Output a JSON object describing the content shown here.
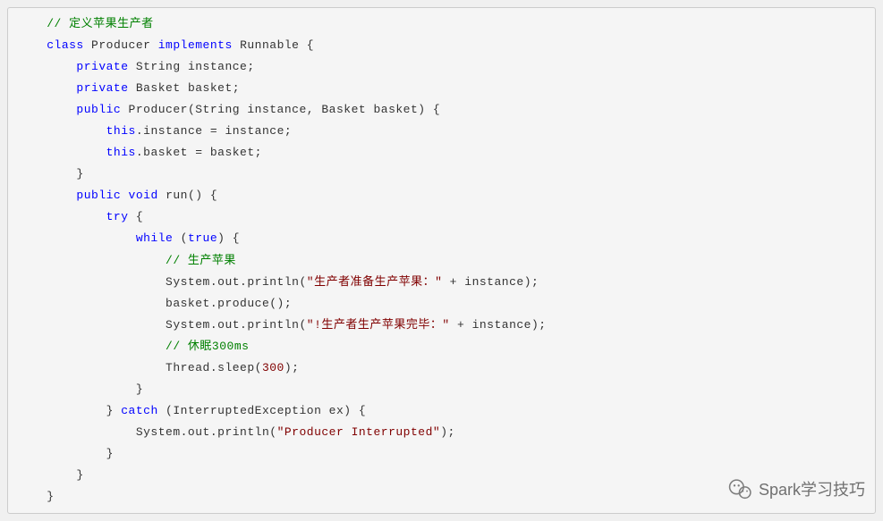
{
  "code": {
    "lines": [
      {
        "indent": 1,
        "tokens": [
          {
            "t": "comment",
            "v": "// 定义苹果生产者"
          }
        ]
      },
      {
        "indent": 1,
        "tokens": [
          {
            "t": "keyword",
            "v": "class"
          },
          {
            "t": "plain",
            "v": " Producer "
          },
          {
            "t": "keyword",
            "v": "implements"
          },
          {
            "t": "plain",
            "v": " Runnable {"
          }
        ]
      },
      {
        "indent": 2,
        "tokens": [
          {
            "t": "keyword",
            "v": "private"
          },
          {
            "t": "plain",
            "v": " String instance;"
          }
        ]
      },
      {
        "indent": 2,
        "tokens": [
          {
            "t": "keyword",
            "v": "private"
          },
          {
            "t": "plain",
            "v": " Basket basket;"
          }
        ]
      },
      {
        "indent": 0,
        "tokens": [
          {
            "t": "plain",
            "v": ""
          }
        ]
      },
      {
        "indent": 2,
        "tokens": [
          {
            "t": "keyword",
            "v": "public"
          },
          {
            "t": "plain",
            "v": " Producer(String instance, Basket basket) {"
          }
        ]
      },
      {
        "indent": 3,
        "tokens": [
          {
            "t": "keyword",
            "v": "this"
          },
          {
            "t": "plain",
            "v": ".instance = instance;"
          }
        ]
      },
      {
        "indent": 3,
        "tokens": [
          {
            "t": "keyword",
            "v": "this"
          },
          {
            "t": "plain",
            "v": ".basket = basket;"
          }
        ]
      },
      {
        "indent": 2,
        "tokens": [
          {
            "t": "plain",
            "v": "}"
          }
        ]
      },
      {
        "indent": 0,
        "tokens": [
          {
            "t": "plain",
            "v": ""
          }
        ]
      },
      {
        "indent": 2,
        "tokens": [
          {
            "t": "keyword",
            "v": "public"
          },
          {
            "t": "plain",
            "v": " "
          },
          {
            "t": "keyword",
            "v": "void"
          },
          {
            "t": "plain",
            "v": " run() {"
          }
        ]
      },
      {
        "indent": 3,
        "tokens": [
          {
            "t": "keyword",
            "v": "try"
          },
          {
            "t": "plain",
            "v": " {"
          }
        ]
      },
      {
        "indent": 4,
        "tokens": [
          {
            "t": "keyword",
            "v": "while"
          },
          {
            "t": "plain",
            "v": " ("
          },
          {
            "t": "keyword",
            "v": "true"
          },
          {
            "t": "plain",
            "v": ") {"
          }
        ]
      },
      {
        "indent": 5,
        "tokens": [
          {
            "t": "comment",
            "v": "// 生产苹果"
          }
        ]
      },
      {
        "indent": 5,
        "tokens": [
          {
            "t": "plain",
            "v": "System.out.println("
          },
          {
            "t": "string",
            "v": "\"生产者准备生产苹果：\""
          },
          {
            "t": "plain",
            "v": " + instance);"
          }
        ]
      },
      {
        "indent": 5,
        "tokens": [
          {
            "t": "plain",
            "v": "basket.produce();"
          }
        ]
      },
      {
        "indent": 5,
        "tokens": [
          {
            "t": "plain",
            "v": "System.out.println("
          },
          {
            "t": "string",
            "v": "\"!生产者生产苹果完毕：\""
          },
          {
            "t": "plain",
            "v": " + instance);"
          }
        ]
      },
      {
        "indent": 5,
        "tokens": [
          {
            "t": "comment",
            "v": "// 休眠300ms"
          }
        ]
      },
      {
        "indent": 5,
        "tokens": [
          {
            "t": "plain",
            "v": "Thread.sleep("
          },
          {
            "t": "string",
            "v": "300"
          },
          {
            "t": "plain",
            "v": ");"
          }
        ]
      },
      {
        "indent": 4,
        "tokens": [
          {
            "t": "plain",
            "v": "}"
          }
        ]
      },
      {
        "indent": 3,
        "tokens": [
          {
            "t": "plain",
            "v": "} "
          },
          {
            "t": "keyword",
            "v": "catch"
          },
          {
            "t": "plain",
            "v": " (InterruptedException ex) {"
          }
        ]
      },
      {
        "indent": 4,
        "tokens": [
          {
            "t": "plain",
            "v": "System.out.println("
          },
          {
            "t": "string",
            "v": "\"Producer Interrupted\""
          },
          {
            "t": "plain",
            "v": ");"
          }
        ]
      },
      {
        "indent": 3,
        "tokens": [
          {
            "t": "plain",
            "v": "}"
          }
        ]
      },
      {
        "indent": 2,
        "tokens": [
          {
            "t": "plain",
            "v": "}"
          }
        ]
      },
      {
        "indent": 1,
        "tokens": [
          {
            "t": "plain",
            "v": "}"
          }
        ]
      }
    ]
  },
  "watermark": {
    "text": "Spark学习技巧"
  }
}
